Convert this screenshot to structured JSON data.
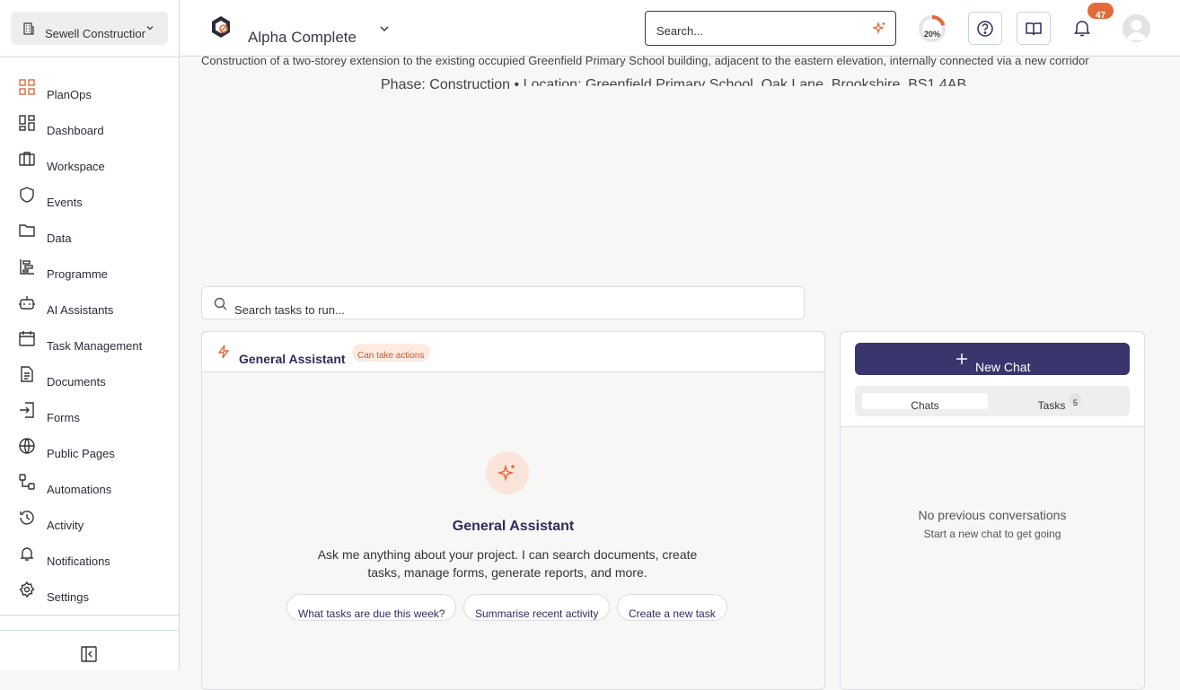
{
  "sidebar": {
    "org_name": "Sewell Construction",
    "items": [
      {
        "label": "PlanOps",
        "icon": "grid-icon"
      },
      {
        "label": "Dashboard",
        "icon": "dashboard-icon"
      },
      {
        "label": "Workspace",
        "icon": "briefcase-icon"
      },
      {
        "label": "Events",
        "icon": "shield-icon"
      },
      {
        "label": "Data",
        "icon": "folder-icon"
      },
      {
        "label": "Programme",
        "icon": "programme-icon"
      },
      {
        "label": "AI Assistants",
        "icon": "bot-icon"
      },
      {
        "label": "Task Management",
        "icon": "calendar-icon"
      },
      {
        "label": "Documents",
        "icon": "document-icon"
      },
      {
        "label": "Forms",
        "icon": "form-icon"
      },
      {
        "label": "Public Pages",
        "icon": "globe-icon"
      },
      {
        "label": "Automations",
        "icon": "workflow-icon"
      },
      {
        "label": "Activity",
        "icon": "history-icon"
      },
      {
        "label": "Notifications",
        "icon": "bell-icon"
      },
      {
        "label": "Settings",
        "icon": "gear-icon"
      }
    ]
  },
  "header": {
    "project_name": "Alpha Complete",
    "search_placeholder": "Search...",
    "progress_percent": "20%",
    "progress_value": 0.2,
    "notification_count": "47"
  },
  "project": {
    "description": "Construction of a two-storey extension to the existing occupied Greenfield Primary School building, adjacent to the eastern elevation, internally connected via a new corridor",
    "phase": "Phase: Construction •",
    "location": "Location: Greenfield Primary School, Oak Lane, Brookshire, BS1 4AB"
  },
  "task_search": {
    "placeholder": "Search tasks to run..."
  },
  "assistant": {
    "title": "General Assistant",
    "badge": "Can take actions",
    "hero_title": "General Assistant",
    "hero_description": "Ask me anything about your project. I can search documents, create tasks, manage forms, generate reports, and more.",
    "suggestions": [
      "What tasks are due this week?",
      "Summarise recent activity",
      "Create a new task"
    ]
  },
  "chats": {
    "new_chat_label": "New Chat",
    "tab_chats": "Chats",
    "tab_tasks": "Tasks",
    "tasks_count": "5",
    "empty_title": "No previous conversations",
    "empty_subtitle": "Start a new chat to get going"
  },
  "colors": {
    "accent": "#e26a3a",
    "primary": "#38366c",
    "heading": "#2e2c5e"
  }
}
